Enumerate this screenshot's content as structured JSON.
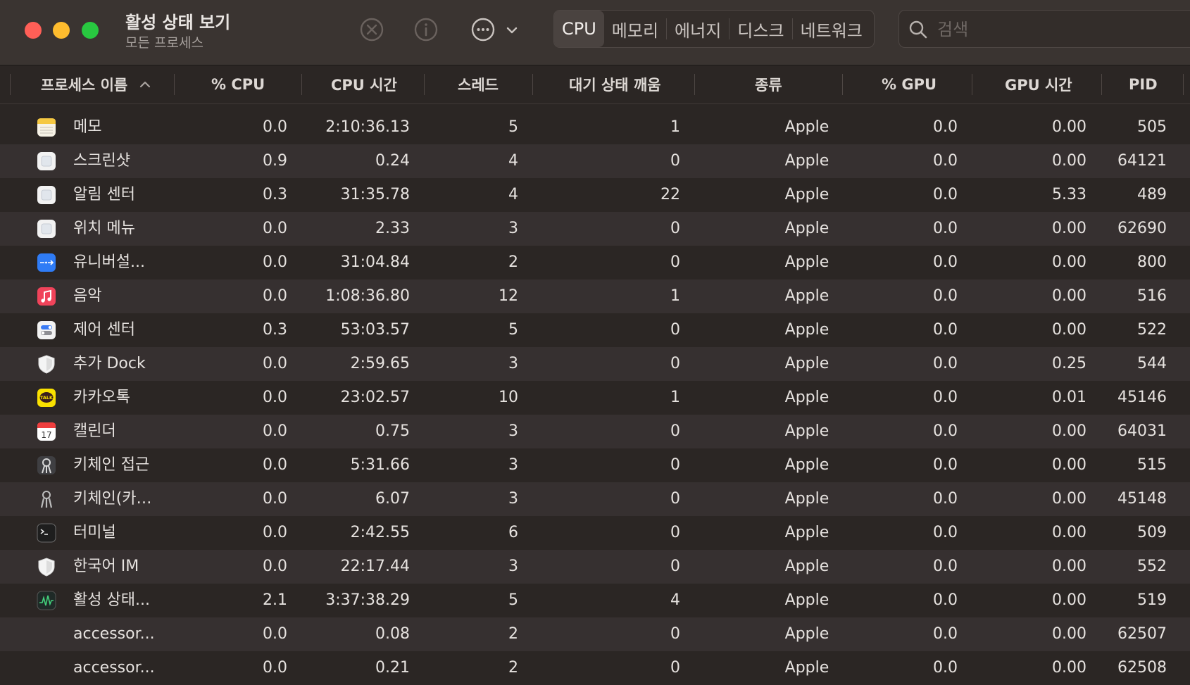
{
  "window": {
    "title": "활성 상태 보기",
    "subtitle": "모든 프로세스"
  },
  "toolbar": {
    "icons": [
      "stop-process-icon",
      "info-icon",
      "more-icon",
      "chevron-down-icon"
    ],
    "tabs": [
      "CPU",
      "메모리",
      "에너지",
      "디스크",
      "네트워크"
    ],
    "active_tab": "CPU",
    "search_placeholder": "검색"
  },
  "columns": {
    "name": "프로세스 이름",
    "cpu": "% CPU",
    "cpu_time": "CPU 시간",
    "threads": "스레드",
    "idle_wake": "대기 상태 깨움",
    "kind": "종류",
    "gpu": "% GPU",
    "gpu_time": "GPU 시간",
    "pid": "PID",
    "sort_indicator": "chevron-up-icon"
  },
  "processes": [
    {
      "icon": "notes-icon",
      "name": "메모",
      "cpu": "0.0",
      "cpu_time": "2:10:36.13",
      "threads": "5",
      "idle_wake": "1",
      "kind": "Apple",
      "gpu": "0.0",
      "gpu_time": "0.00",
      "pid": "505"
    },
    {
      "icon": "generic-app-icon",
      "name": "스크린샷",
      "cpu": "0.9",
      "cpu_time": "0.24",
      "threads": "4",
      "idle_wake": "0",
      "kind": "Apple",
      "gpu": "0.0",
      "gpu_time": "0.00",
      "pid": "64121"
    },
    {
      "icon": "generic-app-icon",
      "name": "알림 센터",
      "cpu": "0.3",
      "cpu_time": "31:35.78",
      "threads": "4",
      "idle_wake": "22",
      "kind": "Apple",
      "gpu": "0.0",
      "gpu_time": "5.33",
      "pid": "489"
    },
    {
      "icon": "generic-app-icon",
      "name": "위치 메뉴",
      "cpu": "0.0",
      "cpu_time": "2.33",
      "threads": "3",
      "idle_wake": "0",
      "kind": "Apple",
      "gpu": "0.0",
      "gpu_time": "0.00",
      "pid": "62690"
    },
    {
      "icon": "universal-control-icon",
      "name": "유니버설...",
      "cpu": "0.0",
      "cpu_time": "31:04.84",
      "threads": "2",
      "idle_wake": "0",
      "kind": "Apple",
      "gpu": "0.0",
      "gpu_time": "0.00",
      "pid": "800"
    },
    {
      "icon": "music-icon",
      "name": "음악",
      "cpu": "0.0",
      "cpu_time": "1:08:36.80",
      "threads": "12",
      "idle_wake": "1",
      "kind": "Apple",
      "gpu": "0.0",
      "gpu_time": "0.00",
      "pid": "516"
    },
    {
      "icon": "control-center-icon",
      "name": "제어 센터",
      "cpu": "0.3",
      "cpu_time": "53:03.57",
      "threads": "5",
      "idle_wake": "0",
      "kind": "Apple",
      "gpu": "0.0",
      "gpu_time": "0.00",
      "pid": "522"
    },
    {
      "icon": "shield-icon",
      "name": "추가 Dock",
      "cpu": "0.0",
      "cpu_time": "2:59.65",
      "threads": "3",
      "idle_wake": "0",
      "kind": "Apple",
      "gpu": "0.0",
      "gpu_time": "0.25",
      "pid": "544"
    },
    {
      "icon": "kakaotalk-icon",
      "name": "카카오톡",
      "cpu": "0.0",
      "cpu_time": "23:02.57",
      "threads": "10",
      "idle_wake": "1",
      "kind": "Apple",
      "gpu": "0.0",
      "gpu_time": "0.01",
      "pid": "45146"
    },
    {
      "icon": "calendar-icon",
      "name": "캘린더",
      "cpu": "0.0",
      "cpu_time": "0.75",
      "threads": "3",
      "idle_wake": "0",
      "kind": "Apple",
      "gpu": "0.0",
      "gpu_time": "0.00",
      "pid": "64031"
    },
    {
      "icon": "keychain-access-icon",
      "name": "키체인 접근",
      "cpu": "0.0",
      "cpu_time": "5:31.66",
      "threads": "3",
      "idle_wake": "0",
      "kind": "Apple",
      "gpu": "0.0",
      "gpu_time": "0.00",
      "pid": "515"
    },
    {
      "icon": "keychain-icon",
      "name": "키체인(카…",
      "cpu": "0.0",
      "cpu_time": "6.07",
      "threads": "3",
      "idle_wake": "0",
      "kind": "Apple",
      "gpu": "0.0",
      "gpu_time": "0.00",
      "pid": "45148"
    },
    {
      "icon": "terminal-icon",
      "name": "터미널",
      "cpu": "0.0",
      "cpu_time": "2:42.55",
      "threads": "6",
      "idle_wake": "0",
      "kind": "Apple",
      "gpu": "0.0",
      "gpu_time": "0.00",
      "pid": "509"
    },
    {
      "icon": "shield-icon",
      "name": "한국어 IM",
      "cpu": "0.0",
      "cpu_time": "22:17.44",
      "threads": "3",
      "idle_wake": "0",
      "kind": "Apple",
      "gpu": "0.0",
      "gpu_time": "0.00",
      "pid": "552"
    },
    {
      "icon": "activity-monitor-icon",
      "name": "활성 상태...",
      "cpu": "2.1",
      "cpu_time": "3:37:38.29",
      "threads": "5",
      "idle_wake": "4",
      "kind": "Apple",
      "gpu": "0.0",
      "gpu_time": "0.00",
      "pid": "519"
    },
    {
      "icon": "",
      "name": "accessor...",
      "cpu": "0.0",
      "cpu_time": "0.08",
      "threads": "2",
      "idle_wake": "0",
      "kind": "Apple",
      "gpu": "0.0",
      "gpu_time": "0.00",
      "pid": "62507"
    },
    {
      "icon": "",
      "name": "accessor...",
      "cpu": "0.0",
      "cpu_time": "0.21",
      "threads": "2",
      "idle_wake": "0",
      "kind": "Apple",
      "gpu": "0.0",
      "gpu_time": "0.00",
      "pid": "62508"
    }
  ],
  "colors": {
    "window_bg": "#2b2624",
    "row_alt": "#363030",
    "toolbar_bg": "#3a3431",
    "close": "#ff5f57",
    "minimize": "#febc2e",
    "maximize": "#28c840"
  }
}
